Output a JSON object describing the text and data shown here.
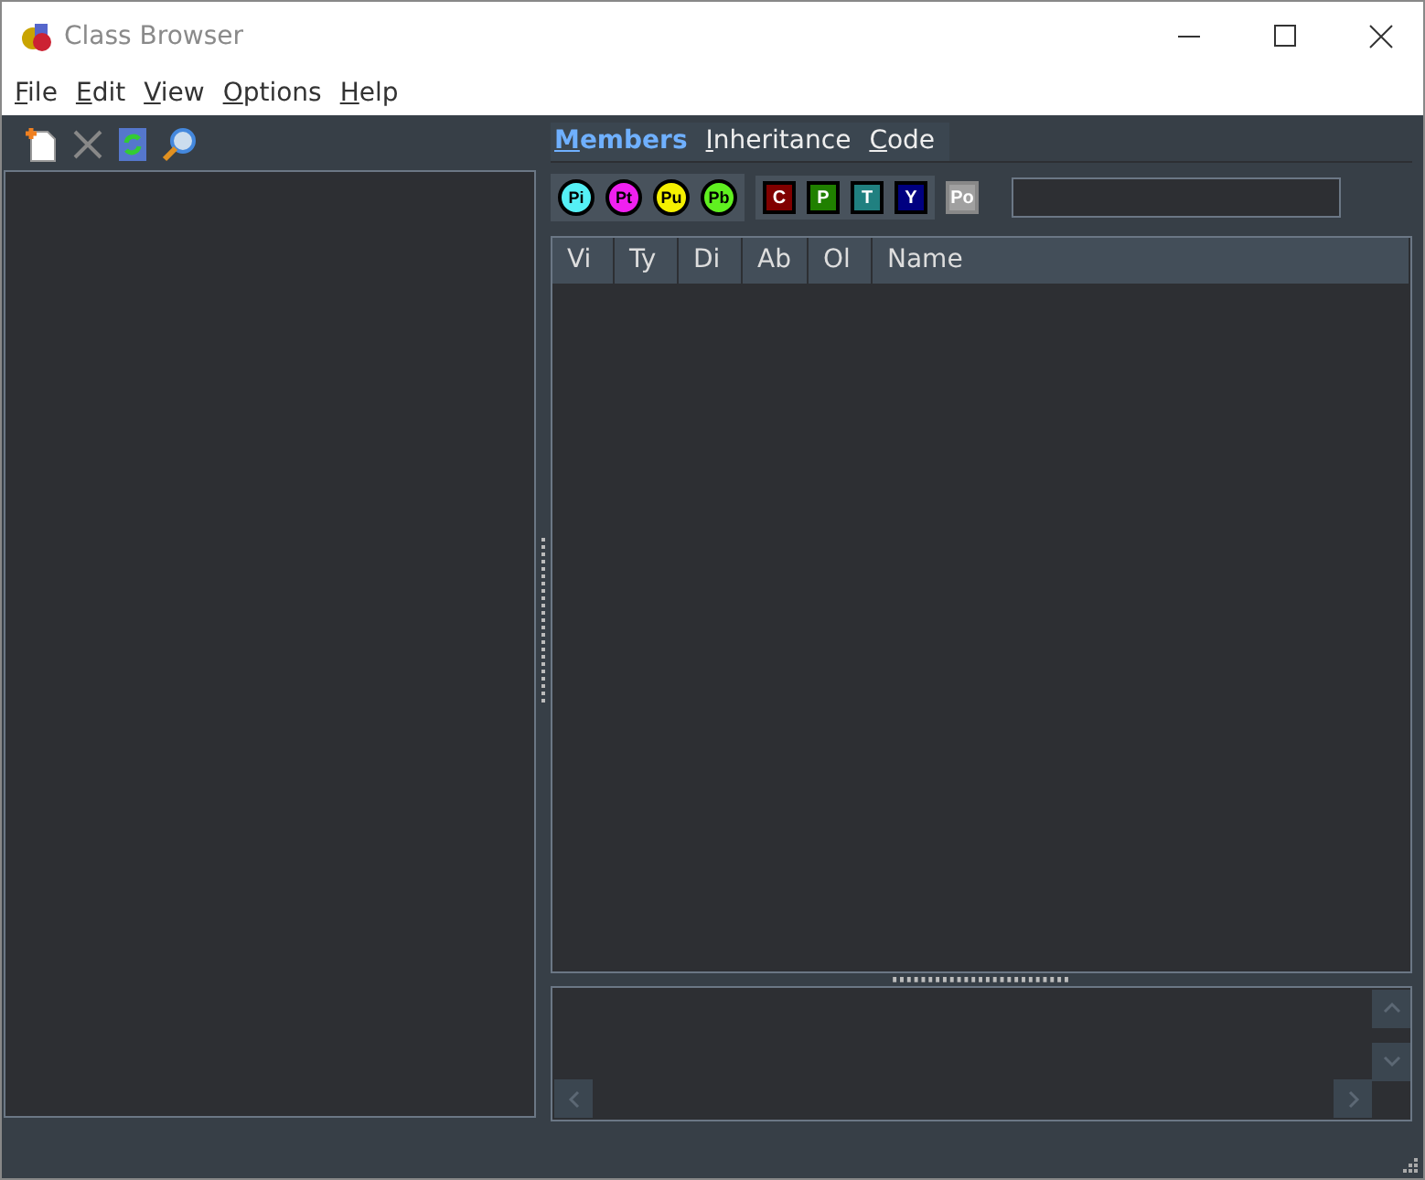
{
  "window": {
    "title": "Class Browser"
  },
  "menu": [
    "File",
    "Edit",
    "View",
    "Options",
    "Help"
  ],
  "tabs": [
    {
      "label": "Members",
      "selected": true
    },
    {
      "label": "Inheritance",
      "selected": false
    },
    {
      "label": "Code",
      "selected": false
    }
  ],
  "scope_filters": [
    {
      "label": "Pi",
      "color": "#55f0f5"
    },
    {
      "label": "Pt",
      "color": "#f020f0"
    },
    {
      "label": "Pu",
      "color": "#f5f000"
    },
    {
      "label": "Pb",
      "color": "#60f020"
    }
  ],
  "type_filters": [
    {
      "label": "C",
      "color": "#800000",
      "disabled": false
    },
    {
      "label": "P",
      "color": "#208000",
      "disabled": false
    },
    {
      "label": "T",
      "color": "#208080",
      "disabled": false
    },
    {
      "label": "Y",
      "color": "#000080",
      "disabled": false
    },
    {
      "label": "Po",
      "color": "#a0a0a0",
      "disabled": true
    }
  ],
  "columns": [
    "Vi",
    "Ty",
    "Di",
    "Ab",
    "Ol",
    "Name"
  ]
}
